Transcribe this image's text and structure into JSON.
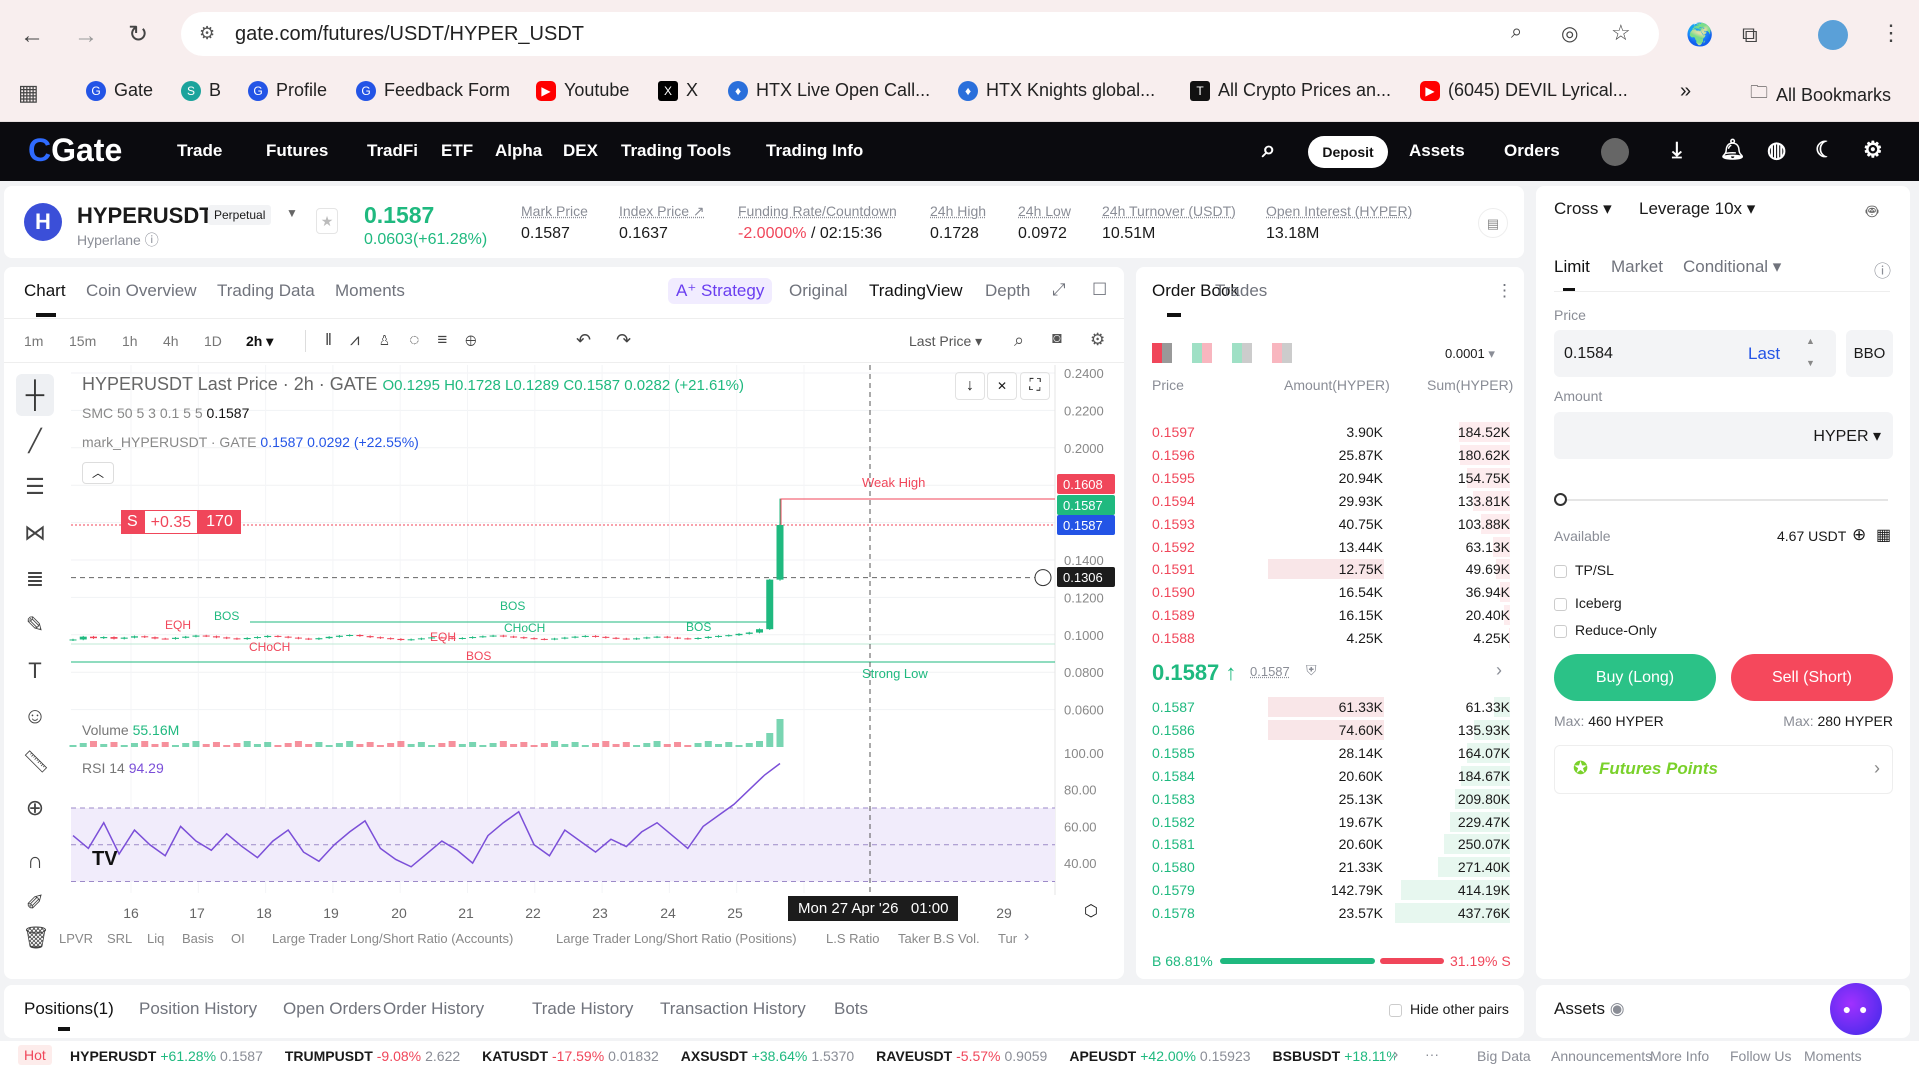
{
  "browser": {
    "url": "gate.com/futures/USDT/HYPER_USDT",
    "bookmarks": [
      "Gate",
      "B",
      "Profile",
      "Feedback Form",
      "Youtube",
      "X",
      "HTX Live Open Call...",
      "HTX Knights global...",
      "All Crypto Prices an...",
      "(6045) DEVIL Lyrical..."
    ],
    "all_bookmarks": "All Bookmarks"
  },
  "nav": {
    "logo": "Gate",
    "items": [
      "Trade",
      "Futures",
      "TradFi",
      "ETF",
      "Alpha",
      "DEX",
      "Trading Tools",
      "Trading Info"
    ],
    "deposit": "Deposit",
    "assets": "Assets",
    "orders": "Orders"
  },
  "header": {
    "symbol": "HYPERUSDT",
    "badge": "Perpetual",
    "name": "Hyperlane",
    "price": "0.1587",
    "change": "0.0603(+61.28%)",
    "stats": [
      {
        "label": "Mark Price",
        "value": "0.1587"
      },
      {
        "label": "Index Price ↗",
        "value": "0.1637"
      },
      {
        "label": "Funding Rate/Countdown",
        "value": "-2.0000%",
        "value2": " / 02:15:36"
      },
      {
        "label": "24h High",
        "value": "0.1728"
      },
      {
        "label": "24h Low",
        "value": "0.0972"
      },
      {
        "label": "24h Turnover (USDT)",
        "value": "10.51M"
      },
      {
        "label": "Open Interest (HYPER)",
        "value": "13.18M"
      }
    ]
  },
  "chart_tabs": [
    "Chart",
    "Coin Overview",
    "Trading Data",
    "Moments"
  ],
  "view_tabs": {
    "strategy": "A⁺ Strategy",
    "original": "Original",
    "tradingview": "TradingView",
    "depth": "Depth"
  },
  "intervals": [
    "1m",
    "15m",
    "1h",
    "4h",
    "1D",
    "2h ▾"
  ],
  "last_price_select": "Last Price ▾",
  "legend": {
    "title": "HYPERUSDT Last Price · 2h · GATE",
    "ohlc": "O0.1295 H0.1728 L0.1289 C0.1587 0.0282 (+21.61%)",
    "smc": "SMC 50 5 3 0.1 5 5",
    "smc_val": "0.1587",
    "mark": "mark_HYPERUSDT · GATE",
    "mark_val": "0.1587 0.0292 (+22.55%)",
    "volume": "Volume",
    "volume_val": "55.16M",
    "rsi": "RSI 14",
    "rsi_val": "94.29"
  },
  "position_tag": {
    "side": "S",
    "pnl": "+0.35",
    "qty": "170"
  },
  "annotations": {
    "weak_high": "Weak High",
    "strong_low": "Strong Low",
    "labels": [
      "EQH",
      "BOS",
      "CHoCH",
      "BOS",
      "EQH",
      "CHoCH",
      "BOS",
      "BOS"
    ]
  },
  "price_axis": [
    "0.2400",
    "0.2200",
    "0.2000",
    "0.1400",
    "0.1200",
    "0.1000",
    "0.0800",
    "0.0600"
  ],
  "price_tags": [
    "0.1608",
    "0.1587",
    "0.1587",
    "0.1306"
  ],
  "rsi_axis": [
    "100.00",
    "80.00",
    "60.00",
    "40.00"
  ],
  "x_axis": [
    "16",
    "17",
    "18",
    "19",
    "20",
    "21",
    "22",
    "23",
    "24",
    "25",
    "29"
  ],
  "crosshair_time": "Mon 27 Apr '26   01:00",
  "indicators": [
    "LPVR",
    "SRL",
    "Liq",
    "Basis",
    "OI",
    "Large Trader Long/Short Ratio (Accounts)",
    "Large Trader Long/Short Ratio (Positions)",
    "L.S Ratio",
    "Taker B.S Vol.",
    "Tur"
  ],
  "chart_data": {
    "type": "candlestick",
    "symbol": "HYPERUSDT",
    "interval": "2h",
    "closes": [
      0.0975,
      0.099,
      0.0982,
      0.0988,
      0.0979,
      0.0985,
      0.0992,
      0.0987,
      0.098,
      0.0978,
      0.0984,
      0.099,
      0.0996,
      0.0992,
      0.0986,
      0.0981,
      0.0977,
      0.0983,
      0.0988,
      0.0994,
      0.099,
      0.0985,
      0.098,
      0.0976,
      0.0982,
      0.0989,
      0.0995,
      0.0999,
      0.0993,
      0.0987,
      0.0982,
      0.0978,
      0.0972,
      0.0976,
      0.0981,
      0.0986,
      0.0984,
      0.0979,
      0.0983,
      0.0988,
      0.0992,
      0.0996,
      0.0991,
      0.0987,
      0.0982,
      0.0978,
      0.0975,
      0.098,
      0.0985,
      0.099,
      0.0994,
      0.0989,
      0.0984,
      0.098,
      0.0977,
      0.0981,
      0.0986,
      0.099,
      0.0985,
      0.0981,
      0.0978,
      0.0983,
      0.0989,
      0.0994,
      0.0998,
      0.1005,
      0.1012,
      0.103,
      0.1295,
      0.1587
    ],
    "last_high": 0.1728,
    "last_low": 0.1289,
    "ylim": [
      0.06,
      0.24
    ],
    "rsi": [
      55,
      48,
      62,
      45,
      58,
      50,
      44,
      60,
      52,
      47,
      56,
      49,
      43,
      52,
      58,
      46,
      41,
      50,
      57,
      63,
      48,
      42,
      38,
      45,
      52,
      47,
      40,
      55,
      62,
      68,
      50,
      44,
      58,
      52,
      46,
      53,
      49,
      57,
      62,
      55,
      48,
      60,
      66,
      72,
      80,
      88,
      94.29
    ],
    "rsi_ylim": [
      30,
      100
    ]
  },
  "orderbook": {
    "tabs": [
      "Order Book",
      "Trades"
    ],
    "precision": "0.0001",
    "headers": [
      "Price",
      "Amount(HYPER)",
      "Sum(HYPER)"
    ],
    "asks": [
      [
        "0.1597",
        "3.90K",
        "184.52K"
      ],
      [
        "0.1596",
        "25.87K",
        "180.62K"
      ],
      [
        "0.1595",
        "20.94K",
        "154.75K"
      ],
      [
        "0.1594",
        "29.93K",
        "133.81K"
      ],
      [
        "0.1593",
        "40.75K",
        "103.88K"
      ],
      [
        "0.1592",
        "13.44K",
        "63.13K"
      ],
      [
        "0.1591",
        "12.75K",
        "49.69K"
      ],
      [
        "0.1590",
        "16.54K",
        "36.94K"
      ],
      [
        "0.1589",
        "16.15K",
        "20.40K"
      ],
      [
        "0.1588",
        "4.25K",
        "4.25K"
      ]
    ],
    "mid": "0.1587 ↑",
    "mid_mark": "0.1587",
    "bids": [
      [
        "0.1587",
        "61.33K",
        "61.33K"
      ],
      [
        "0.1586",
        "74.60K",
        "135.93K"
      ],
      [
        "0.1585",
        "28.14K",
        "164.07K"
      ],
      [
        "0.1584",
        "20.60K",
        "184.67K"
      ],
      [
        "0.1583",
        "25.13K",
        "209.80K"
      ],
      [
        "0.1582",
        "19.67K",
        "229.47K"
      ],
      [
        "0.1581",
        "20.60K",
        "250.07K"
      ],
      [
        "0.1580",
        "21.33K",
        "271.40K"
      ],
      [
        "0.1579",
        "142.79K",
        "414.19K"
      ],
      [
        "0.1578",
        "23.57K",
        "437.76K"
      ]
    ],
    "buy_ratio": "B 68.81%",
    "sell_ratio": "31.19% S",
    "buy_pct": 68.81
  },
  "order_form": {
    "margin": "Cross ▾",
    "leverage": "Leverage 10x ▾",
    "tabs": [
      "Limit",
      "Market",
      "Conditional ▾"
    ],
    "price_label": "Price",
    "price": "0.1584",
    "last": "Last",
    "bbo": "BBO",
    "amount_label": "Amount",
    "unit": "HYPER ▾",
    "available_label": "Available",
    "available": "4.67 USDT",
    "options": [
      "TP/SL",
      "Iceberg",
      "Reduce-Only"
    ],
    "buy": "Buy (Long)",
    "sell": "Sell (Short)",
    "max_buy_label": "Max:",
    "max_buy": "460 HYPER",
    "max_sell_label": "Max:",
    "max_sell": "280 HYPER",
    "futures_points": "Futures Points",
    "slider_pct": 0
  },
  "bottom": {
    "tabs": [
      "Positions(1)",
      "Position History",
      "Open Orders",
      "Order History",
      "Trade History",
      "Transaction History",
      "Bots"
    ],
    "hide_pairs": "Hide other pairs",
    "assets": "Assets"
  },
  "ticker": {
    "hot": "Hot",
    "items": [
      [
        "HYPERUSDT",
        "+61.28%",
        "0.1587"
      ],
      [
        "TRUMPUSDT",
        "-9.08%",
        "2.622"
      ],
      [
        "KATUSDT",
        "-17.59%",
        "0.01832"
      ],
      [
        "AXSUSDT",
        "+38.64%",
        "1.5370"
      ],
      [
        "RAVEUSDT",
        "-5.57%",
        "0.9059"
      ],
      [
        "APEUSDT",
        "+42.00%",
        "0.15923"
      ],
      [
        "BSBUSDT",
        "+18.11%",
        ""
      ]
    ],
    "links": [
      "Big Data",
      "Announcements",
      "More Info",
      "Follow Us",
      "Moments"
    ]
  },
  "colors": {
    "green": "#1fb97f",
    "red": "#f0465a",
    "blue": "#2354e6",
    "nav": "#0b0b0f"
  }
}
